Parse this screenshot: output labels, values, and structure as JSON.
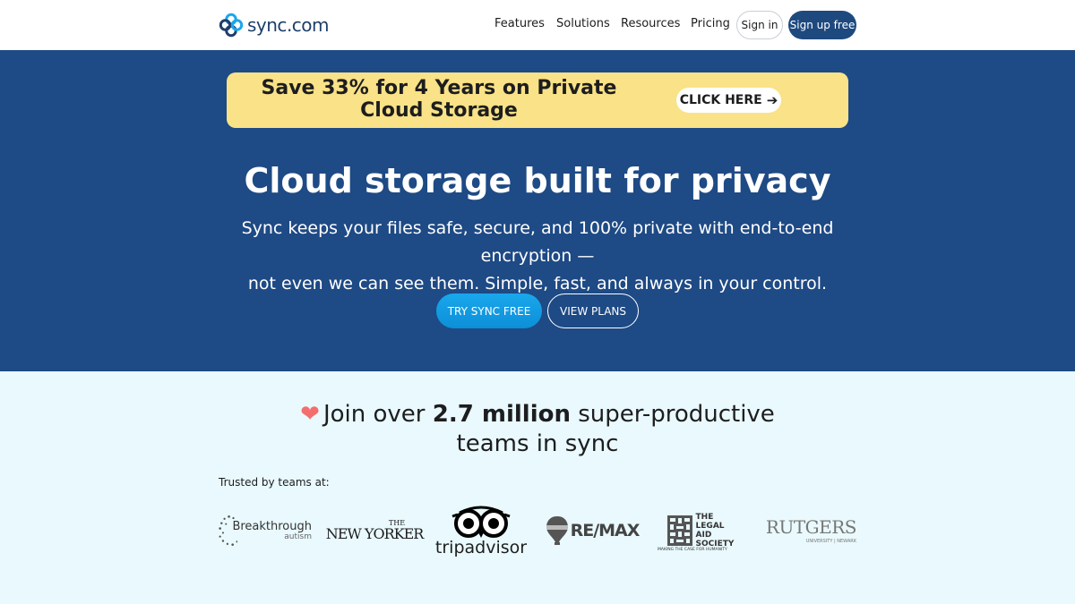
{
  "header": {
    "logo_text": "sync",
    "logo_suffix": ".com",
    "nav": [
      "Features",
      "Solutions",
      "Resources",
      "Pricing"
    ],
    "signin_label": "Sign in",
    "signup_label": "Sign up free"
  },
  "promo": {
    "line1": "Save 33% for 4 Years on Private",
    "line2": "Cloud Storage",
    "cta": "CLICK HERE"
  },
  "hero": {
    "title": "Cloud storage built for privacy",
    "subtitle_line1": "Sync keeps your files safe, secure, and 100% private with end-to-end encryption —",
    "subtitle_line2": "not even we can see them. Simple, fast, and always in your control.",
    "try_label": "TRY SYNC FREE",
    "plans_label": "VIEW PLANS"
  },
  "proof": {
    "join_prefix": "Join over ",
    "join_bold": "2.7 million",
    "join_suffix": " super-productive",
    "join_line2": "teams in sync",
    "trusted_label": "Trusted by teams at:",
    "logos": {
      "breakthrough": "Breakthrough",
      "breakthrough_sub": "autism",
      "newyorker_the": "THE",
      "newyorker": "NEW YORKER",
      "tripadvisor": "tripadvisor",
      "remax": "RE/MAX",
      "legal_the": "THE",
      "legal_1": "LEGAL",
      "legal_2": "AID",
      "legal_3": "SOCIETY",
      "legal_tag": "MAKING THE CASE FOR HUMANITY",
      "rutgers": "RUTGERS",
      "rutgers_sub": "UNIVERSITY | NEWARK"
    }
  },
  "colors": {
    "hero_bg": "#1e4a85",
    "promo_bg": "#f9e287",
    "proof_bg": "#e9f9fd",
    "signup_bg": "#1e497f",
    "try_bg": "#1aa7ec",
    "heart": "#f46e6e"
  }
}
